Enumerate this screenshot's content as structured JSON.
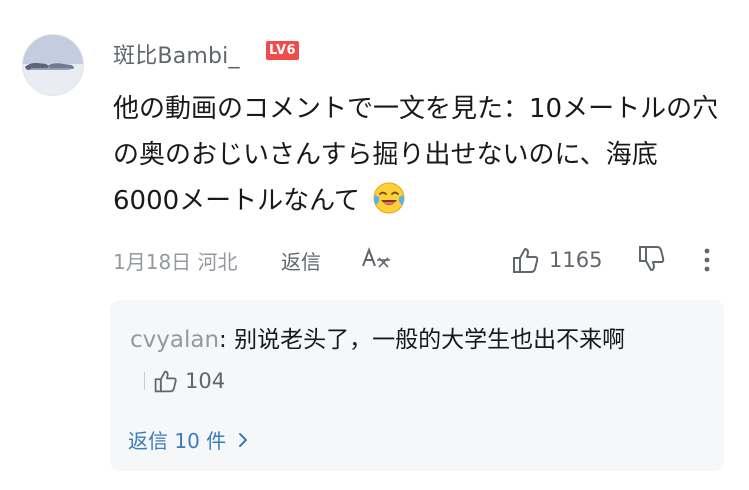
{
  "comment": {
    "username": "斑比Bambi_",
    "level_badge": "LV6",
    "text": "他の動画のコメントで一文を見た：10メートルの穴の奥のおじいさんすら掘り出せないのに、海底6000メートルなんて",
    "emoji": "crying-laughing-emoji",
    "date_location": "1月18日 河北",
    "reply_label": "返信",
    "like_count": "1165"
  },
  "reply": {
    "author": "cvyalan",
    "separator": ":",
    "text": " 别说老头了，一般的大学生也出不来啊",
    "like_count": "104",
    "view_replies_label": "返信 10 件"
  },
  "colors": {
    "accent_blue": "#3a7bbf",
    "level_red": "#f04c49",
    "secondary_text": "#9499a0"
  }
}
